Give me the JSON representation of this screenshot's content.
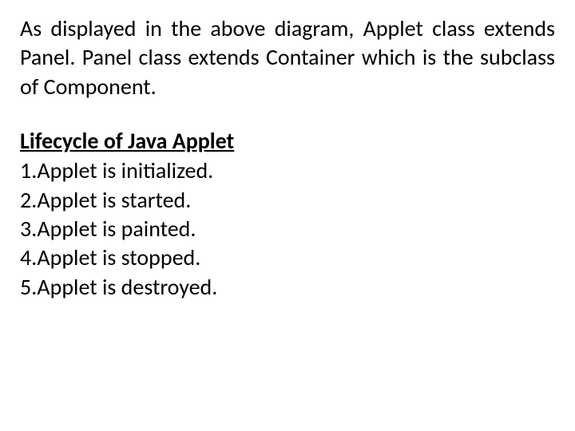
{
  "intro": "As displayed in the above diagram, Applet class extends Panel. Panel class extends Container which is the subclass of Component.",
  "heading": "Lifecycle of Java Applet",
  "items": [
    "1.Applet is initialized.",
    "2.Applet is started.",
    "3.Applet is painted.",
    "4.Applet is stopped.",
    "5.Applet is destroyed."
  ]
}
